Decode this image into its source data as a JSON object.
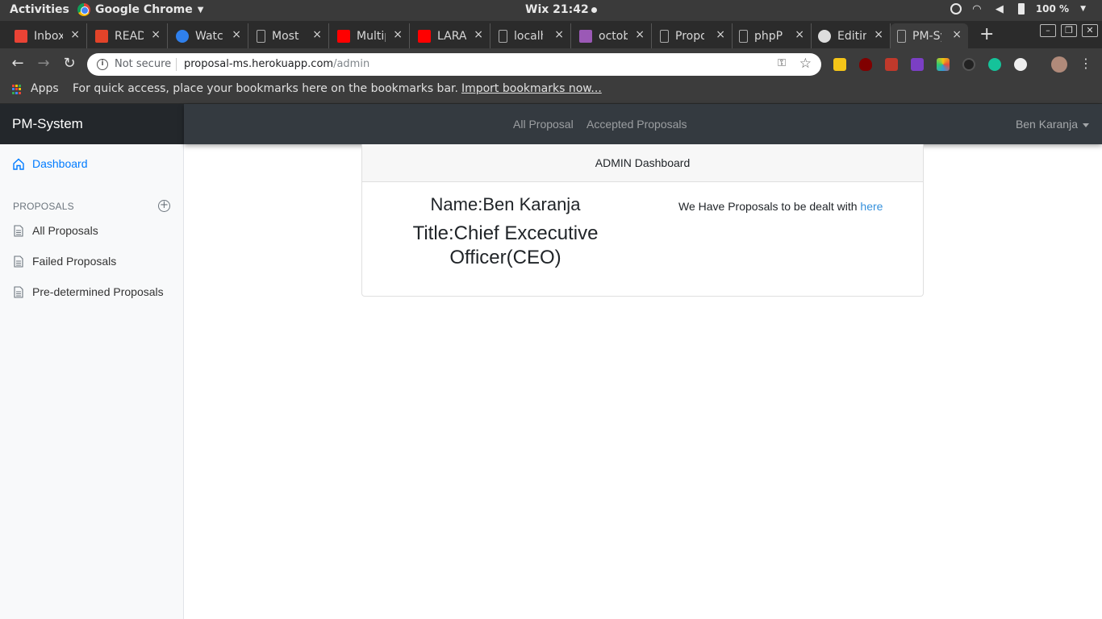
{
  "os": {
    "activities": "Activities",
    "app_name": "Google Chrome",
    "clock": "Wix 21:42",
    "battery": "100 %"
  },
  "tabs": [
    {
      "title": "Inbox",
      "favicon": "gmail-icon",
      "color": "#ea4335"
    },
    {
      "title": "README",
      "favicon": "gitlab-icon",
      "color": "#e24329"
    },
    {
      "title": "Watch",
      "favicon": "play-circle-icon",
      "color": "#2f80ed"
    },
    {
      "title": "Most",
      "favicon": "document-icon",
      "color": "#aaaaaa"
    },
    {
      "title": "Multiple",
      "favicon": "youtube-icon",
      "color": "#ff0000"
    },
    {
      "title": "LARAVEL",
      "favicon": "youtube-icon",
      "color": "#ff0000"
    },
    {
      "title": "localhost",
      "favicon": "document-icon",
      "color": "#aaaaaa"
    },
    {
      "title": "octobre",
      "favicon": "hashtag-icon",
      "color": "#9b59b6"
    },
    {
      "title": "Proposal",
      "favicon": "document-icon",
      "color": "#aaaaaa"
    },
    {
      "title": "phpProposal",
      "favicon": "document-icon",
      "color": "#aaaaaa"
    },
    {
      "title": "Editing",
      "favicon": "github-icon",
      "color": "#dddddd"
    },
    {
      "title": "PM-System",
      "favicon": "document-icon",
      "color": "#aaaaaa",
      "active": true
    }
  ],
  "omnibox": {
    "security": "Not secure",
    "host": "proposal-ms.herokuapp.com",
    "path": "/admin"
  },
  "bookmarks": {
    "apps": "Apps",
    "hint": "For quick access, place your bookmarks here on the bookmarks bar.",
    "import_link": "Import bookmarks now..."
  },
  "app": {
    "brand": "PM-System",
    "nav": {
      "all_proposal": "All Proposal",
      "accepted_proposals": "Accepted Proposals",
      "user": "Ben Karanja"
    },
    "sidebar": {
      "dashboard": "Dashboard",
      "heading": "PROPOSALS",
      "items": [
        {
          "label": "All Proposals"
        },
        {
          "label": "Failed Proposals"
        },
        {
          "label": "Pre-determined Proposals"
        }
      ]
    },
    "card": {
      "header": "ADMIN Dashboard",
      "name": "Name:Ben Karanja",
      "title": "Title:Chief Excecutive Officer(CEO)",
      "message": "We Have Proposals to be dealt with",
      "link": "here"
    }
  },
  "colors": {
    "brand_bg": "#23272b",
    "navbar_bg": "#343a40",
    "accent": "#007bff",
    "link": "#3490dc"
  }
}
